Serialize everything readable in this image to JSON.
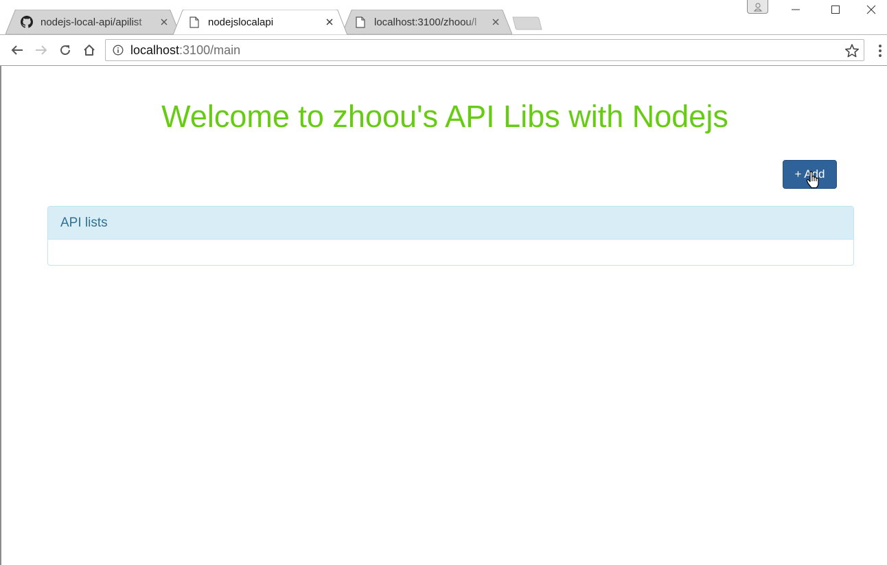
{
  "browser": {
    "tabs": [
      {
        "title": "nodejs-local-api/apilist",
        "icon": "github-icon",
        "active": false
      },
      {
        "title": "nodejslocalapi",
        "icon": "page-icon",
        "active": true
      },
      {
        "title": "localhost:3100/zhoou/l",
        "icon": "page-icon",
        "active": false
      }
    ],
    "address": {
      "host": "localhost",
      "path": ":3100/main"
    }
  },
  "page": {
    "title": "Welcome to zhoou's API Libs with Nodejs",
    "add_button_label": "+ Add",
    "panel": {
      "heading": "API lists",
      "items": []
    }
  },
  "colors": {
    "title_green": "#66cc11",
    "button_blue": "#2e6299",
    "panel_heading_bg": "#d9edf7",
    "panel_heading_text": "#31708f"
  }
}
